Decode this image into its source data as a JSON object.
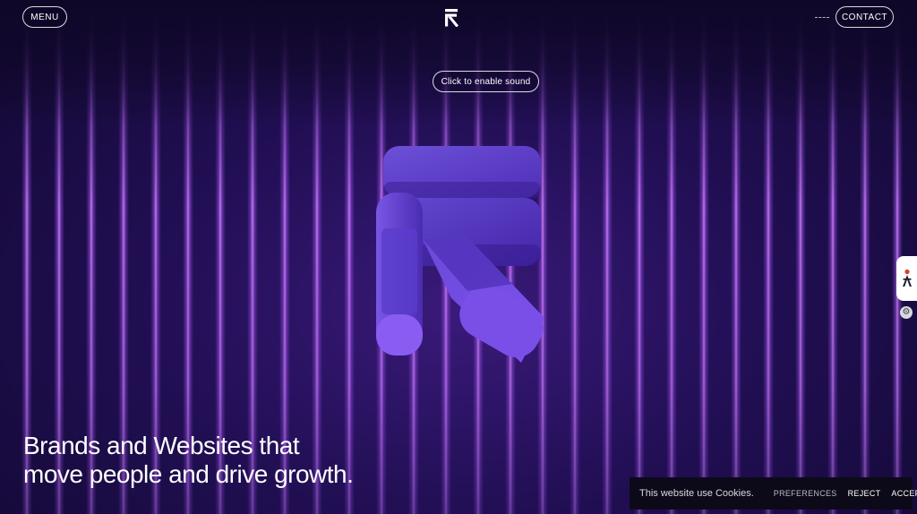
{
  "header": {
    "menu_label": "MENU",
    "contact_label": "CONTACT",
    "logo_icon": "brand-logo-icon"
  },
  "sound": {
    "label": "Click to enable sound"
  },
  "hero": {
    "line1": "Brands and Websites that",
    "line2": "move people and drive growth.",
    "mark_icon": "brand-3d-logo"
  },
  "cookies": {
    "message": "This website use Cookies.",
    "preferences_label": "PREFERENCES",
    "reject_label": "REJECT",
    "accept_label": "ACCEPT"
  },
  "widgets": {
    "side_icon": "accessibility-person-icon",
    "settings_icon": "gear-icon"
  },
  "colors": {
    "background": "#130a2e",
    "accent_purple": "#6a45d6",
    "stripe_glow": "#d282ff",
    "cookie_bar": "#0c0a18"
  }
}
